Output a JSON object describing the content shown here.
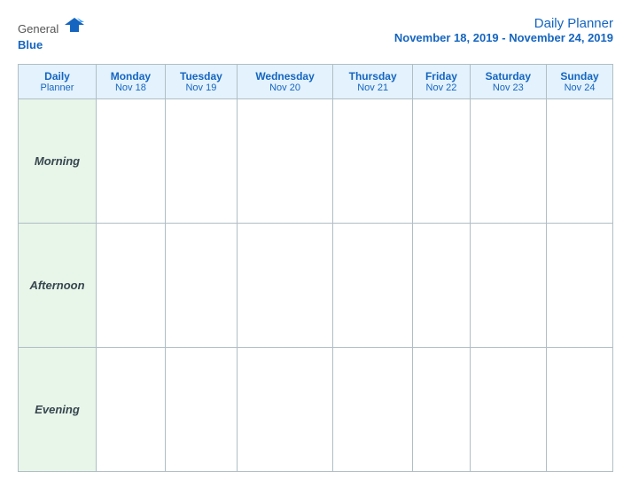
{
  "header": {
    "logo": {
      "general": "General",
      "blue": "Blue"
    },
    "title": "Daily Planner",
    "date_range": "November 18, 2019 - November 24, 2019"
  },
  "table": {
    "columns": [
      {
        "id": "label",
        "day": "Daily",
        "day2": "Planner",
        "date": ""
      },
      {
        "id": "mon",
        "day": "Monday",
        "date": "Nov 18"
      },
      {
        "id": "tue",
        "day": "Tuesday",
        "date": "Nov 19"
      },
      {
        "id": "wed",
        "day": "Wednesday",
        "date": "Nov 20"
      },
      {
        "id": "thu",
        "day": "Thursday",
        "date": "Nov 21"
      },
      {
        "id": "fri",
        "day": "Friday",
        "date": "Nov 22"
      },
      {
        "id": "sat",
        "day": "Saturday",
        "date": "Nov 23"
      },
      {
        "id": "sun",
        "day": "Sunday",
        "date": "Nov 24"
      }
    ],
    "rows": [
      {
        "id": "morning",
        "label": "Morning"
      },
      {
        "id": "afternoon",
        "label": "Afternoon"
      },
      {
        "id": "evening",
        "label": "Evening"
      }
    ]
  }
}
